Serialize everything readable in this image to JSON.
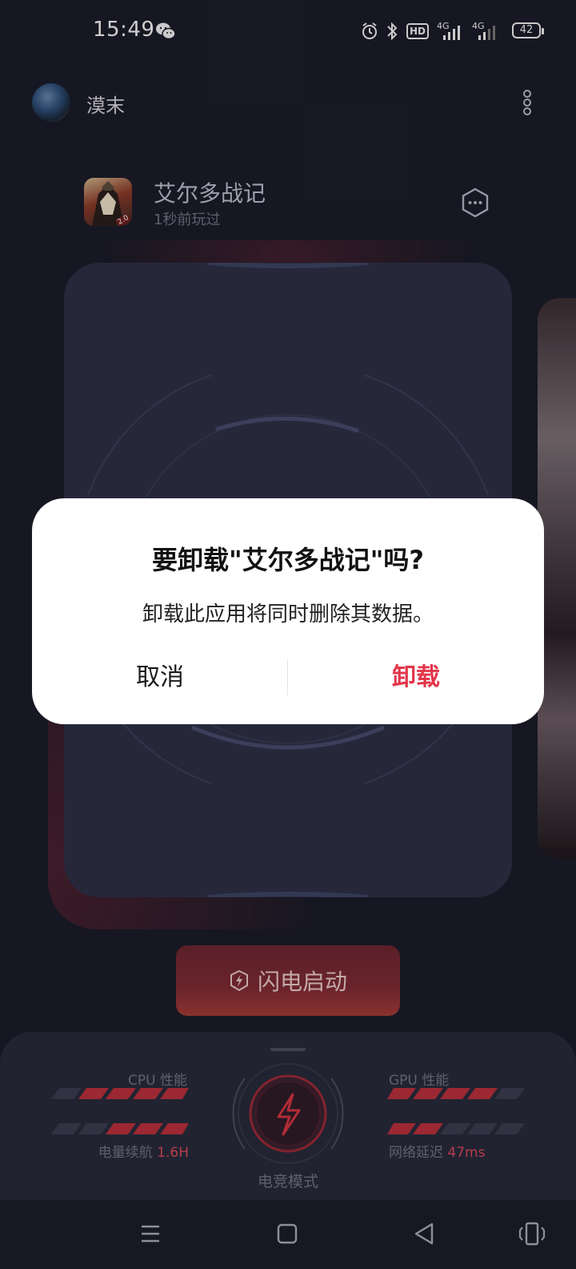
{
  "status_bar": {
    "time": "15:49",
    "hd_label": "HD",
    "net1": "4G",
    "net2": "4G",
    "battery": "42"
  },
  "header": {
    "username": "漠末"
  },
  "game": {
    "name": "艾尔多战记",
    "last_played": "1秒前玩过",
    "icon_badge": "2.0"
  },
  "launch": {
    "label": "闪电启动"
  },
  "panel": {
    "cpu_label": "CPU 性能",
    "gpu_label": "GPU 性能",
    "battery_label": "电量续航",
    "battery_value": "1.6H",
    "latency_label": "网络延迟",
    "latency_value": "47ms",
    "mode_label": "电竞模式"
  },
  "dialog": {
    "title": "要卸载\"艾尔多战记\"吗?",
    "message": "卸载此应用将同时删除其数据。",
    "cancel_label": "取消",
    "confirm_label": "卸载"
  },
  "colors": {
    "accent_red": "#e3364b",
    "background": "#1b1c28",
    "card": "#2d3045"
  }
}
